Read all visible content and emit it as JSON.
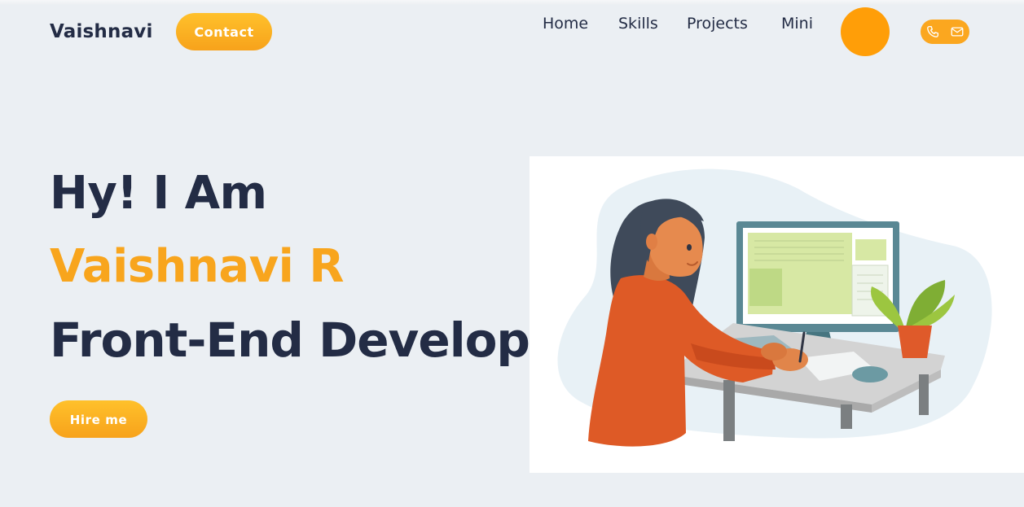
{
  "header": {
    "brand": "Vaishnavi",
    "contact_label": "Contact",
    "nav": [
      {
        "label": "Home"
      },
      {
        "label": "Skills"
      },
      {
        "label": "Projects"
      },
      {
        "label": "Mini"
      }
    ],
    "icons": [
      "phone-icon",
      "mail-icon"
    ]
  },
  "hero": {
    "greeting": "Hy! I Am",
    "name": "Vaishnavi R",
    "role": "Front-End Developer",
    "hire_label": "Hire me"
  },
  "colors": {
    "background": "#ebeff3",
    "accent": "#f8a51d",
    "text": "#232c45"
  }
}
